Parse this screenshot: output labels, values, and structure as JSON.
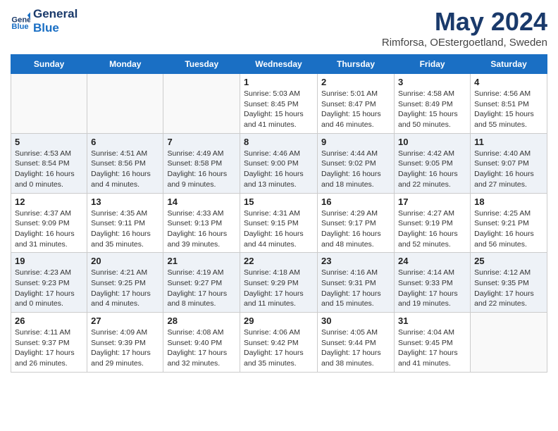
{
  "header": {
    "logo_line1": "General",
    "logo_line2": "Blue",
    "title": "May 2024",
    "subtitle": "Rimforsa, OEstergoetland, Sweden"
  },
  "weekdays": [
    "Sunday",
    "Monday",
    "Tuesday",
    "Wednesday",
    "Thursday",
    "Friday",
    "Saturday"
  ],
  "weeks": [
    [
      {
        "day": "",
        "info": ""
      },
      {
        "day": "",
        "info": ""
      },
      {
        "day": "",
        "info": ""
      },
      {
        "day": "1",
        "info": "Sunrise: 5:03 AM\nSunset: 8:45 PM\nDaylight: 15 hours\nand 41 minutes."
      },
      {
        "day": "2",
        "info": "Sunrise: 5:01 AM\nSunset: 8:47 PM\nDaylight: 15 hours\nand 46 minutes."
      },
      {
        "day": "3",
        "info": "Sunrise: 4:58 AM\nSunset: 8:49 PM\nDaylight: 15 hours\nand 50 minutes."
      },
      {
        "day": "4",
        "info": "Sunrise: 4:56 AM\nSunset: 8:51 PM\nDaylight: 15 hours\nand 55 minutes."
      }
    ],
    [
      {
        "day": "5",
        "info": "Sunrise: 4:53 AM\nSunset: 8:54 PM\nDaylight: 16 hours\nand 0 minutes."
      },
      {
        "day": "6",
        "info": "Sunrise: 4:51 AM\nSunset: 8:56 PM\nDaylight: 16 hours\nand 4 minutes."
      },
      {
        "day": "7",
        "info": "Sunrise: 4:49 AM\nSunset: 8:58 PM\nDaylight: 16 hours\nand 9 minutes."
      },
      {
        "day": "8",
        "info": "Sunrise: 4:46 AM\nSunset: 9:00 PM\nDaylight: 16 hours\nand 13 minutes."
      },
      {
        "day": "9",
        "info": "Sunrise: 4:44 AM\nSunset: 9:02 PM\nDaylight: 16 hours\nand 18 minutes."
      },
      {
        "day": "10",
        "info": "Sunrise: 4:42 AM\nSunset: 9:05 PM\nDaylight: 16 hours\nand 22 minutes."
      },
      {
        "day": "11",
        "info": "Sunrise: 4:40 AM\nSunset: 9:07 PM\nDaylight: 16 hours\nand 27 minutes."
      }
    ],
    [
      {
        "day": "12",
        "info": "Sunrise: 4:37 AM\nSunset: 9:09 PM\nDaylight: 16 hours\nand 31 minutes."
      },
      {
        "day": "13",
        "info": "Sunrise: 4:35 AM\nSunset: 9:11 PM\nDaylight: 16 hours\nand 35 minutes."
      },
      {
        "day": "14",
        "info": "Sunrise: 4:33 AM\nSunset: 9:13 PM\nDaylight: 16 hours\nand 39 minutes."
      },
      {
        "day": "15",
        "info": "Sunrise: 4:31 AM\nSunset: 9:15 PM\nDaylight: 16 hours\nand 44 minutes."
      },
      {
        "day": "16",
        "info": "Sunrise: 4:29 AM\nSunset: 9:17 PM\nDaylight: 16 hours\nand 48 minutes."
      },
      {
        "day": "17",
        "info": "Sunrise: 4:27 AM\nSunset: 9:19 PM\nDaylight: 16 hours\nand 52 minutes."
      },
      {
        "day": "18",
        "info": "Sunrise: 4:25 AM\nSunset: 9:21 PM\nDaylight: 16 hours\nand 56 minutes."
      }
    ],
    [
      {
        "day": "19",
        "info": "Sunrise: 4:23 AM\nSunset: 9:23 PM\nDaylight: 17 hours\nand 0 minutes."
      },
      {
        "day": "20",
        "info": "Sunrise: 4:21 AM\nSunset: 9:25 PM\nDaylight: 17 hours\nand 4 minutes."
      },
      {
        "day": "21",
        "info": "Sunrise: 4:19 AM\nSunset: 9:27 PM\nDaylight: 17 hours\nand 8 minutes."
      },
      {
        "day": "22",
        "info": "Sunrise: 4:18 AM\nSunset: 9:29 PM\nDaylight: 17 hours\nand 11 minutes."
      },
      {
        "day": "23",
        "info": "Sunrise: 4:16 AM\nSunset: 9:31 PM\nDaylight: 17 hours\nand 15 minutes."
      },
      {
        "day": "24",
        "info": "Sunrise: 4:14 AM\nSunset: 9:33 PM\nDaylight: 17 hours\nand 19 minutes."
      },
      {
        "day": "25",
        "info": "Sunrise: 4:12 AM\nSunset: 9:35 PM\nDaylight: 17 hours\nand 22 minutes."
      }
    ],
    [
      {
        "day": "26",
        "info": "Sunrise: 4:11 AM\nSunset: 9:37 PM\nDaylight: 17 hours\nand 26 minutes."
      },
      {
        "day": "27",
        "info": "Sunrise: 4:09 AM\nSunset: 9:39 PM\nDaylight: 17 hours\nand 29 minutes."
      },
      {
        "day": "28",
        "info": "Sunrise: 4:08 AM\nSunset: 9:40 PM\nDaylight: 17 hours\nand 32 minutes."
      },
      {
        "day": "29",
        "info": "Sunrise: 4:06 AM\nSunset: 9:42 PM\nDaylight: 17 hours\nand 35 minutes."
      },
      {
        "day": "30",
        "info": "Sunrise: 4:05 AM\nSunset: 9:44 PM\nDaylight: 17 hours\nand 38 minutes."
      },
      {
        "day": "31",
        "info": "Sunrise: 4:04 AM\nSunset: 9:45 PM\nDaylight: 17 hours\nand 41 minutes."
      },
      {
        "day": "",
        "info": ""
      }
    ]
  ]
}
